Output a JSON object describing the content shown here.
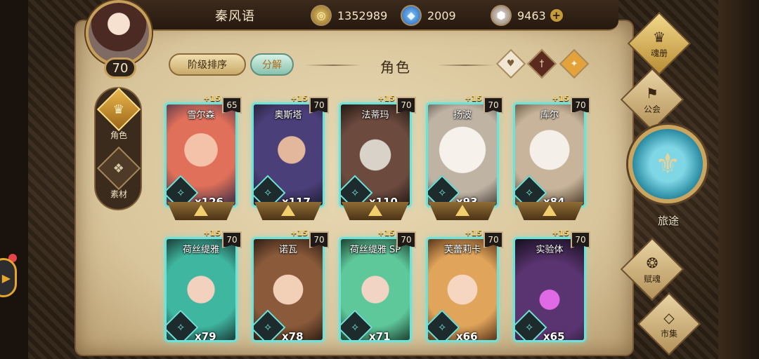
{
  "header": {
    "player_name": "秦风语",
    "level": "70",
    "resources": [
      {
        "name": "gold",
        "icon": "gold-coin-icon",
        "value": "1352989"
      },
      {
        "name": "crystal",
        "icon": "blue-crystal-icon",
        "value": "2009"
      },
      {
        "name": "ore",
        "icon": "ore-gem-icon",
        "value": "9463"
      }
    ]
  },
  "side_tabs": [
    {
      "label": "角色",
      "icon": "character-icon"
    },
    {
      "label": "素材",
      "icon": "material-icon"
    }
  ],
  "toolbar": {
    "sort_label": "阶级排序",
    "decompose_label": "分解",
    "section_title": "角色"
  },
  "cards": [
    {
      "name": "雪尔森",
      "level": "65",
      "bonus": "+15",
      "count": "x126"
    },
    {
      "name": "奥斯塔",
      "level": "70",
      "bonus": "+15",
      "count": "x117"
    },
    {
      "name": "法蒂玛",
      "level": "70",
      "bonus": "+15",
      "count": "x110"
    },
    {
      "name": "扬波",
      "level": "70",
      "bonus": "+15",
      "count": "x93"
    },
    {
      "name": "库尔",
      "level": "70",
      "bonus": "+15",
      "count": "x84"
    },
    {
      "name": "荷丝缇雅",
      "level": "70",
      "bonus": "+15",
      "count": "x79"
    },
    {
      "name": "诺瓦",
      "level": "70",
      "bonus": "+15",
      "count": "x78"
    },
    {
      "name": "荷丝缇雅 SP",
      "level": "70",
      "bonus": "+15",
      "count": "x71"
    },
    {
      "name": "芙蕾莉卡",
      "level": "70",
      "bonus": "+15",
      "count": "x66"
    },
    {
      "name": "实验体",
      "level": "70",
      "bonus": "+15",
      "count": "x65"
    }
  ],
  "right_nav": {
    "soul_book": "魂册",
    "guild": "公会",
    "journey": "旅途",
    "soul_grant": "赋魂",
    "market": "市集"
  },
  "colors": {
    "card_border": "#6fe1d6",
    "parchment": "#e9d9b4",
    "accent_gold": "#c6a05a"
  }
}
